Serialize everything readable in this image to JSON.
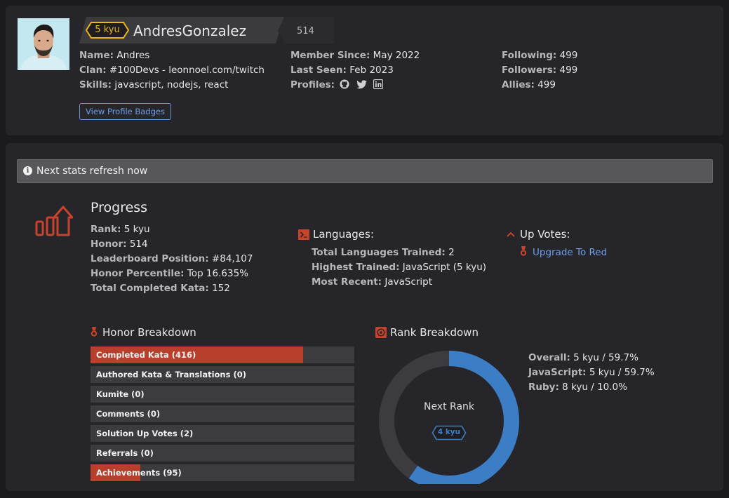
{
  "profile": {
    "rank_badge": "5 kyu",
    "username": "AndresGonzalez",
    "honor": "514",
    "name_label": "Name:",
    "name_value": "Andres",
    "clan_label": "Clan:",
    "clan_value": "#100Devs - leonnoel.com/twitch",
    "skills_label": "Skills:",
    "skills_value": "javascript, nodejs, react",
    "member_label": "Member Since:",
    "member_value": "May 2022",
    "seen_label": "Last Seen:",
    "seen_value": "Feb 2023",
    "profiles_label": "Profiles:",
    "following_label": "Following:",
    "following_value": "499",
    "followers_label": "Followers:",
    "followers_value": "499",
    "allies_label": "Allies:",
    "allies_value": "499",
    "badges_button": "View Profile Badges",
    "profile_icons": [
      "github-icon",
      "twitter-icon",
      "linkedin-icon"
    ]
  },
  "notice": {
    "text": "Next stats refresh now"
  },
  "progress": {
    "title": "Progress",
    "rank_label": "Rank:",
    "rank_value": "5 kyu",
    "honor_label": "Honor:",
    "honor_value": "514",
    "leaderboard_label": "Leaderboard Position:",
    "leaderboard_value": "#84,107",
    "percentile_label": "Honor Percentile:",
    "percentile_value": "Top 16.635%",
    "completed_label": "Total Completed Kata:",
    "completed_value": "152"
  },
  "languages": {
    "title": "Languages:",
    "trained_label": "Total Languages Trained:",
    "trained_value": "2",
    "highest_label": "Highest Trained:",
    "highest_value": "JavaScript (5 kyu)",
    "recent_label": "Most Recent:",
    "recent_value": "JavaScript"
  },
  "upvotes": {
    "title": "Up Votes:",
    "link": "Upgrade To Red"
  },
  "honor_breakdown": {
    "title": "Honor Breakdown",
    "bars": [
      {
        "label": "Completed Kata (416)",
        "fill": 0.805
      },
      {
        "label": "Authored Kata & Translations (0)",
        "fill": 0
      },
      {
        "label": "Kumite (0)",
        "fill": 0
      },
      {
        "label": "Comments (0)",
        "fill": 0
      },
      {
        "label": "Solution Up Votes (2)",
        "fill": 0
      },
      {
        "label": "Referrals (0)",
        "fill": 0
      },
      {
        "label": "Achievements (95)",
        "fill": 0.19
      }
    ]
  },
  "rank_breakdown": {
    "title": "Rank Breakdown",
    "next_rank_label": "Next Rank",
    "next_rank_badge": "4 kyu",
    "progress": 0.597,
    "overall_label": "Overall:",
    "overall_value": "5 kyu / 59.7%",
    "js_label": "JavaScript:",
    "js_value": "5 kyu / 59.7%",
    "ruby_label": "Ruby:",
    "ruby_value": "8 kyu / 10.0%"
  },
  "colors": {
    "accent_red": "#b73f2b",
    "kyu_yellow": "#ecb613",
    "link_blue": "#6e9fe8",
    "donut_blue": "#3c7ec5"
  }
}
